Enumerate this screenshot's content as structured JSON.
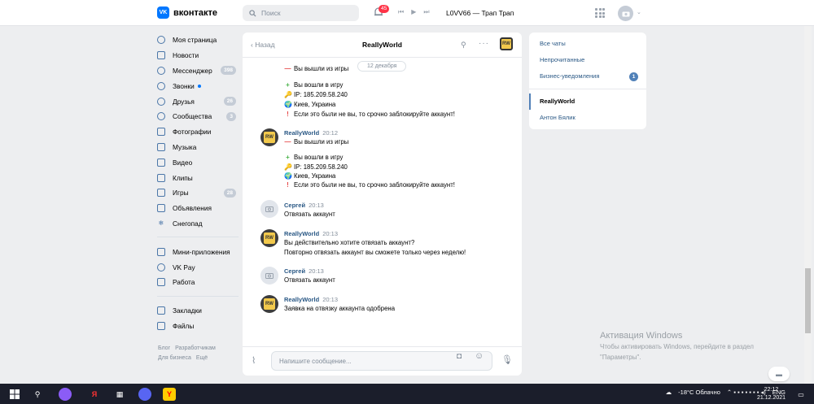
{
  "header": {
    "logo_text": "вконтакте",
    "search_placeholder": "Поиск",
    "notifications_count": "45",
    "track": "L0VV66 — Трап Трап"
  },
  "nav": {
    "items": [
      {
        "label": "Моя страница",
        "count": ""
      },
      {
        "label": "Новости",
        "count": ""
      },
      {
        "label": "Мессенджер",
        "count": "398"
      },
      {
        "label": "Звонки",
        "count": ""
      },
      {
        "label": "Друзья",
        "count": "26"
      },
      {
        "label": "Сообщества",
        "count": "3"
      },
      {
        "label": "Фотографии",
        "count": ""
      },
      {
        "label": "Музыка",
        "count": ""
      },
      {
        "label": "Видео",
        "count": ""
      },
      {
        "label": "Клипы",
        "count": ""
      },
      {
        "label": "Игры",
        "count": "28"
      },
      {
        "label": "Объявления",
        "count": ""
      },
      {
        "label": "Снегопад",
        "count": ""
      }
    ],
    "items2": [
      {
        "label": "Мини-приложения"
      },
      {
        "label": "VK Pay"
      },
      {
        "label": "Работа"
      }
    ],
    "items3": [
      {
        "label": "Закладки"
      },
      {
        "label": "Файлы"
      }
    ],
    "footer": [
      "Блог",
      "Разработчикам",
      "Для бизнеса",
      "Ещё"
    ]
  },
  "chat": {
    "back": "Назад",
    "title": "ReallyWorld",
    "date": "12 декабря",
    "top_exit": "Вы вышли из игры",
    "block1": {
      "enter": "Вы вошли в игру",
      "ip": "IP: 185.209.58.240",
      "city": "Киев, Украина",
      "warn": "Если это были не вы, то срочно заблокируйте аккаунт!"
    },
    "m1": {
      "author": "ReallyWorld",
      "time": "20:12",
      "text": "Вы вышли из игры"
    },
    "block2": {
      "enter": "Вы вошли в игру",
      "ip": "IP: 185.209.58.240",
      "city": "Киев, Украина",
      "warn": "Если это были не вы, то срочно заблокируйте аккаунт!"
    },
    "m2": {
      "author": "Сергей",
      "time": "20:13",
      "text": "Отвязать аккаунт"
    },
    "m3": {
      "author": "ReallyWorld",
      "time": "20:13",
      "text": "Вы действительно хотите отвязать аккаунт?",
      "text2": "Повторно отвязать аккаунт вы сможете только через неделю!"
    },
    "m4": {
      "author": "Сергей",
      "time": "20:13",
      "text": "Отвязать аккаунт"
    },
    "m5": {
      "author": "ReallyWorld",
      "time": "20:13",
      "text": "Заявка на отвязку аккаунта одобрена"
    },
    "composer_placeholder": "Напишите сообщение..."
  },
  "right": {
    "all": "Все чаты",
    "unread": "Непрочитанные",
    "business": "Бизнес-уведомления",
    "business_count": "1",
    "chat1": "ReallyWorld",
    "chat2": "Антон Бялик"
  },
  "windows": {
    "activation_title": "Активация Windows",
    "activation_text1": "Чтобы активировать Windows, перейдите в раздел",
    "activation_text2": "\"Параметры\"."
  },
  "taskbar": {
    "weather": "-18°C  Облачно",
    "lang": "ENG",
    "time": "22:12",
    "date": "21.12.2021"
  }
}
